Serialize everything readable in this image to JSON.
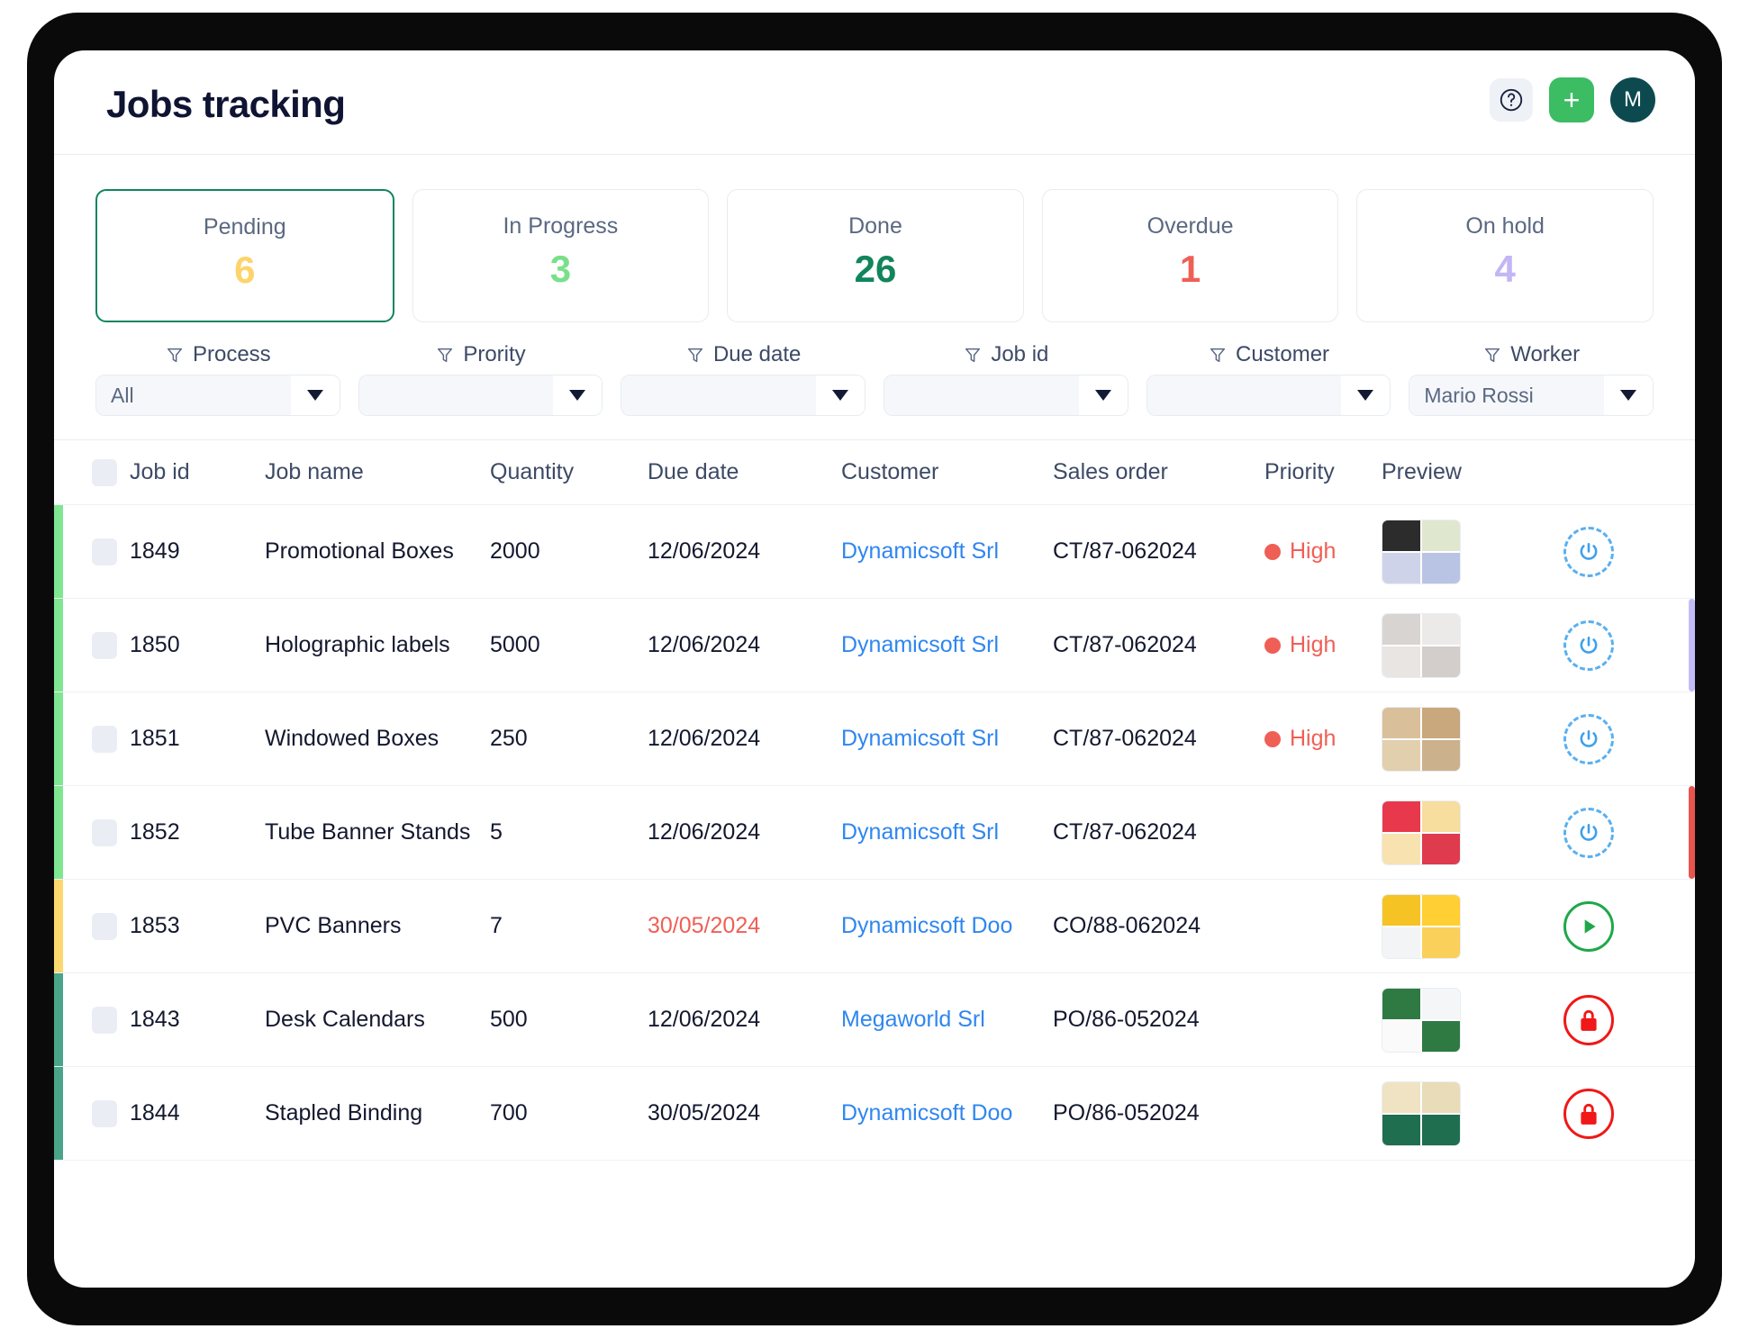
{
  "header": {
    "title": "Jobs tracking",
    "help_icon": "question-circle-icon",
    "add_label": "+",
    "avatar_initial": "M",
    "accent_green": "#3cbc63",
    "avatar_bg": "#0d4a50"
  },
  "status_cards": [
    {
      "label": "Pending",
      "count": "6",
      "color": "#fcd469",
      "selected": true
    },
    {
      "label": "In Progress",
      "count": "3",
      "color": "#79e08a",
      "selected": false
    },
    {
      "label": "Done",
      "count": "26",
      "color": "#11855c",
      "selected": false
    },
    {
      "label": "Overdue",
      "count": "1",
      "color": "#ef5f56",
      "selected": false
    },
    {
      "label": "On hold",
      "count": "4",
      "color": "#c3b6f5",
      "selected": false
    }
  ],
  "filters": [
    {
      "label": "Process",
      "value": "All",
      "placeholder": ""
    },
    {
      "label": "Prority",
      "value": "",
      "placeholder": ""
    },
    {
      "label": "Due date",
      "value": "",
      "placeholder": ""
    },
    {
      "label": "Job id",
      "value": "",
      "placeholder": ""
    },
    {
      "label": "Customer",
      "value": "",
      "placeholder": ""
    },
    {
      "label": "Worker",
      "value": "Mario Rossi",
      "placeholder": ""
    }
  ],
  "table": {
    "columns": [
      "Job id",
      "Job name",
      "Quantity",
      "Due date",
      "Customer",
      "Sales order",
      "Priority",
      "Preview"
    ],
    "rows": [
      {
        "job_id": "1849",
        "job_name": "Promotional Boxes",
        "quantity": "2000",
        "due_date": "12/06/2024",
        "due_overdue": false,
        "customer": "Dynamicsoft Srl",
        "sales_order": "CT/87-062024",
        "priority": "High",
        "priority_color": "#ef5f56",
        "bar_left": "#7fe691",
        "bar_right": "",
        "preview": "perfume-brand-kit-thumbnail",
        "preview_colors": [
          "#2c2c2c",
          "#dfe8cf",
          "#cfd3ea",
          "#b9c3e4"
        ],
        "action": "reload-icon"
      },
      {
        "job_id": "1850",
        "job_name": "Holographic labels",
        "quantity": "5000",
        "due_date": "12/06/2024",
        "due_overdue": false,
        "customer": "Dynamicsoft Srl",
        "sales_order": "CT/87-062024",
        "priority": "High",
        "priority_color": "#ef5f56",
        "bar_left": "#7fe691",
        "bar_right": "#c3bdf7",
        "preview": "thank-you-sticker-thumbnail",
        "preview_colors": [
          "#d8d4d1",
          "#eceae8",
          "#e9e5e2",
          "#d3cecb"
        ],
        "action": "reload-icon"
      },
      {
        "job_id": "1851",
        "job_name": "Windowed Boxes",
        "quantity": "250",
        "due_date": "12/06/2024",
        "due_overdue": false,
        "customer": "Dynamicsoft Srl",
        "sales_order": "CT/87-062024",
        "priority": "High",
        "priority_color": "#ef5f56",
        "bar_left": "#7fe691",
        "bar_right": "",
        "preview": "skincare-pack-thumbnail",
        "preview_colors": [
          "#d9bf9a",
          "#c8a87c",
          "#e2cfae",
          "#cbb18c"
        ],
        "action": "reload-icon"
      },
      {
        "job_id": "1852",
        "job_name": "Tube Banner Stands",
        "quantity": "5",
        "due_date": "12/06/2024",
        "due_overdue": false,
        "customer": "Dynamicsoft Srl",
        "sales_order": "CT/87-062024",
        "priority": "",
        "priority_color": "",
        "bar_left": "#7fe691",
        "bar_right": "#e8554e",
        "preview": "lamb-shank-menu-thumbnail",
        "preview_colors": [
          "#e8394c",
          "#f7dd9e",
          "#f7e2b0",
          "#e03a4e"
        ],
        "action": "reload-icon"
      },
      {
        "job_id": "1853",
        "job_name": "PVC Banners",
        "quantity": "7",
        "due_date": "30/05/2024",
        "due_overdue": true,
        "customer": "Dynamicsoft Doo",
        "sales_order": "CO/88-062024",
        "priority": "",
        "priority_color": "",
        "bar_left": "#fcd96f",
        "bar_right": "",
        "preview": "digital-marketing-agency-thumbnail",
        "preview_colors": [
          "#f6c324",
          "#ffcf33",
          "#f2f4f6",
          "#fad05a"
        ],
        "action": "play-icon"
      },
      {
        "job_id": "1843",
        "job_name": "Desk Calendars",
        "quantity": "500",
        "due_date": "12/06/2024",
        "due_overdue": false,
        "customer": "Megaworld Srl",
        "sales_order": "PO/86-052024",
        "priority": "",
        "priority_color": "",
        "bar_left": "#4aa588",
        "bar_right": "",
        "preview": "january-desk-calendar-thumbnail",
        "preview_colors": [
          "#2f7a42",
          "#f4f6f7",
          "#fafafa",
          "#2f7a42"
        ],
        "action": "lock-icon"
      },
      {
        "job_id": "1844",
        "job_name": "Stapled Binding",
        "quantity": "700",
        "due_date": "30/05/2024",
        "due_overdue": false,
        "customer": "Dynamicsoft Doo",
        "sales_order": "PO/86-052024",
        "priority": "",
        "priority_color": "",
        "bar_left": "#4aa588",
        "bar_right": "",
        "preview": "eco-brochure-thumbnail",
        "preview_colors": [
          "#efe3c4",
          "#e9dcb8",
          "#1f6e50",
          "#1f6e50"
        ],
        "action": "lock-icon"
      }
    ]
  }
}
